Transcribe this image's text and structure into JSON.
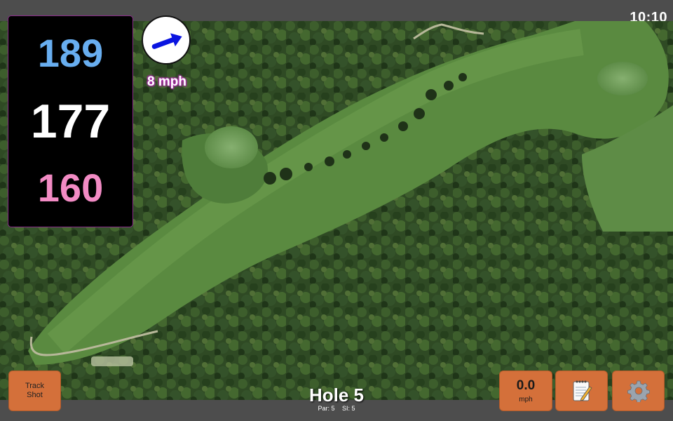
{
  "status": {
    "time": "10:10"
  },
  "distances": {
    "back": "189",
    "middle": "177",
    "front": "160"
  },
  "wind": {
    "speed": "8 mph",
    "icon": "wind-arrow-icon",
    "arrow_color": "#0a14e0"
  },
  "hole": {
    "title": "Hole 5",
    "par": "Par: 5",
    "si": "SI: 5"
  },
  "buttons": {
    "track_line1": "Track",
    "track_line2": "Shot",
    "speed_value": "0.0",
    "speed_unit": "mph",
    "notes_icon": "notepad-icon",
    "settings_icon": "gear-icon"
  },
  "colors": {
    "back": "#68aef0",
    "middle": "#ffffff",
    "front": "#f28bc4",
    "button": "#d4703a",
    "accent": "#8a2a8a"
  }
}
